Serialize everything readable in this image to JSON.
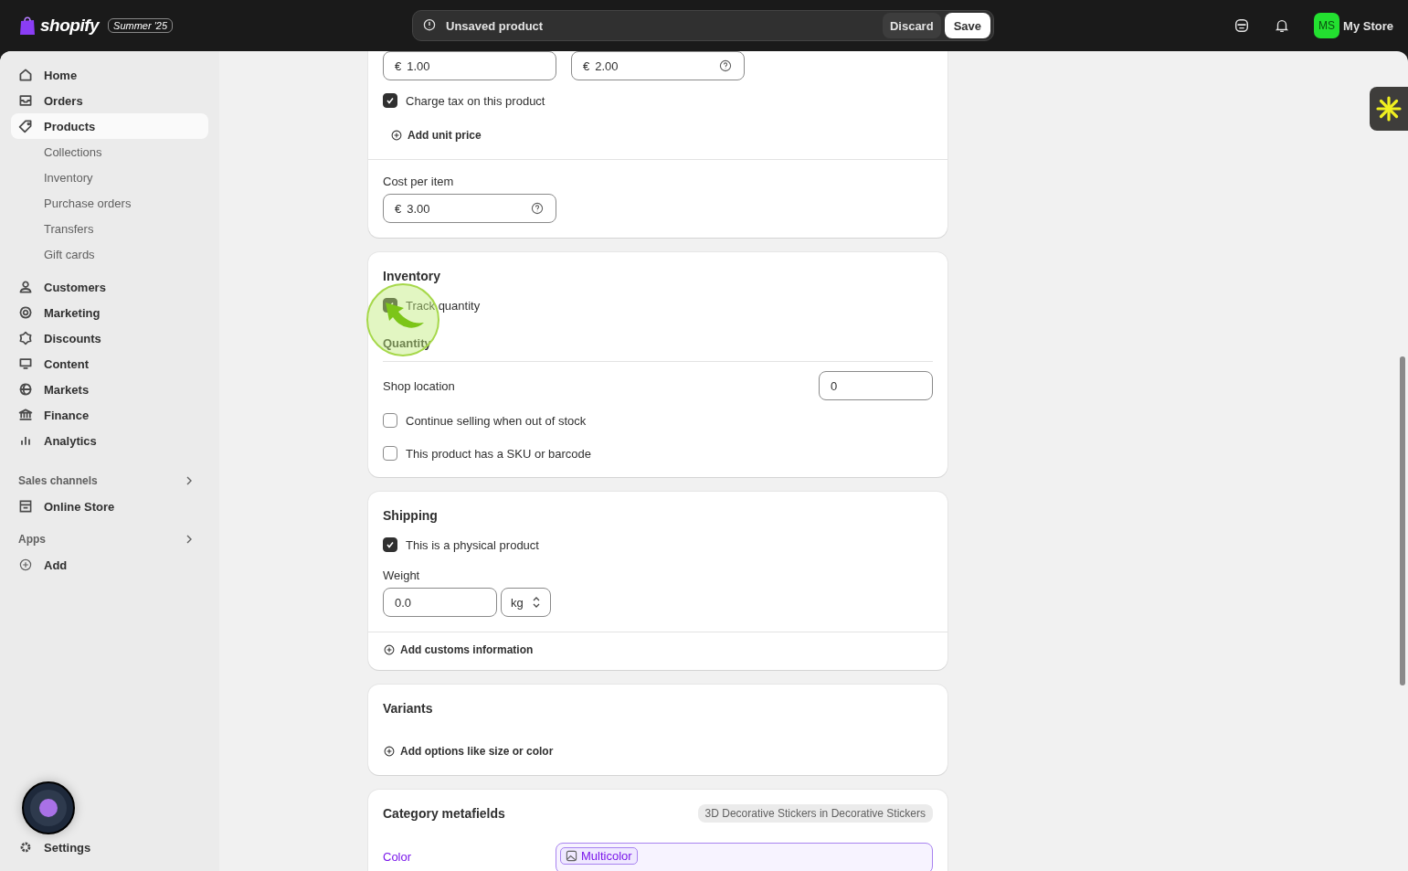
{
  "topbar": {
    "logo_text": "shopify",
    "edition_badge": "Summer '25",
    "unsaved_message": "Unsaved product",
    "discard": "Discard",
    "save": "Save",
    "avatar_initials": "MS",
    "store_name": "My Store"
  },
  "sidebar": {
    "nav_groups": [
      [
        {
          "label": "Home",
          "selected": false
        },
        {
          "label": "Orders",
          "selected": false
        },
        {
          "label": "Products",
          "selected": true,
          "children": [
            {
              "label": "Collections"
            },
            {
              "label": "Inventory"
            },
            {
              "label": "Purchase orders"
            },
            {
              "label": "Transfers"
            },
            {
              "label": "Gift cards"
            }
          ]
        }
      ],
      [
        {
          "label": "Customers",
          "selected": false
        },
        {
          "label": "Marketing",
          "selected": false
        },
        {
          "label": "Discounts",
          "selected": false
        },
        {
          "label": "Content",
          "selected": false
        },
        {
          "label": "Markets",
          "selected": false
        },
        {
          "label": "Finance",
          "selected": false
        },
        {
          "label": "Analytics",
          "selected": false
        }
      ]
    ],
    "sections": [
      {
        "heading": "Sales channels",
        "items": [
          {
            "label": "Online Store"
          }
        ]
      },
      {
        "heading": "Apps",
        "items": [
          {
            "label": "Add"
          }
        ]
      }
    ],
    "settings": "Settings"
  },
  "pricing": {
    "fields": [
      {
        "prefix": "€",
        "value": "1.00",
        "help": false
      },
      {
        "prefix": "€",
        "value": "2.00",
        "help": true
      }
    ],
    "charge_tax": {
      "label": "Charge tax on this product",
      "checked": true
    },
    "add_unit_price": "Add unit price",
    "cost_label": "Cost per item",
    "cost": {
      "prefix": "€",
      "value": "3.00",
      "help": true
    }
  },
  "inventory": {
    "title": "Inventory",
    "track": {
      "label": "Track quantity",
      "checked": true
    },
    "quantity_heading": "Quantity",
    "locations": [
      {
        "name": "Shop location",
        "value": "0"
      }
    ],
    "options": [
      {
        "label": "Continue selling when out of stock",
        "checked": false
      },
      {
        "label": "This product has a SKU or barcode",
        "checked": false
      }
    ]
  },
  "shipping": {
    "title": "Shipping",
    "physical": {
      "label": "This is a physical product",
      "checked": true
    },
    "weight_label": "Weight",
    "weight": "0.0",
    "unit": "kg",
    "add_customs": "Add customs information"
  },
  "variants": {
    "title": "Variants",
    "add_options": "Add options like size or color"
  },
  "metafields": {
    "title": "Category metafields",
    "category": "3D Decorative Stickers in Decorative Stickers",
    "fields": [
      {
        "label": "Color",
        "values": [
          "Multicolor"
        ]
      }
    ]
  }
}
